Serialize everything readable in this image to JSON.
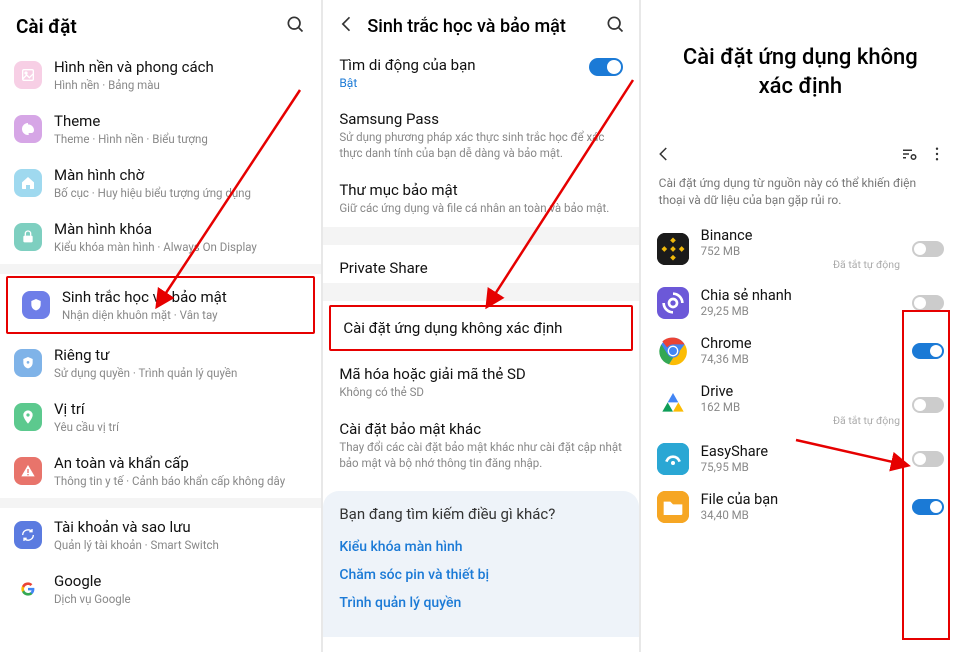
{
  "panel1": {
    "title": "Cài đặt",
    "items": [
      {
        "title": "Hình nền và phong cách",
        "sub": "Hình nền · Bảng màu",
        "bg": "#f7cfe5",
        "icon": "image"
      },
      {
        "title": "Theme",
        "sub": "Theme · Hình nền · Biểu tượng",
        "bg": "#d6a6e6",
        "icon": "palette"
      },
      {
        "title": "Màn hình chờ",
        "sub": "Bố cục · Huy hiệu biểu tượng ứng dụng",
        "bg": "#9fd9ef",
        "icon": "home"
      },
      {
        "title": "Màn hình khóa",
        "sub": "Kiểu khóa màn hình · Always On Display",
        "bg": "#7ecfc0",
        "icon": "lock"
      },
      {
        "title": "Sinh trắc học và bảo mật",
        "sub": "Nhận diện khuôn mặt · Vân tay",
        "bg": "#6e7ee8",
        "icon": "shield",
        "hl": true
      },
      {
        "title": "Riêng tư",
        "sub": "Sử dụng quyền · Trình quản lý quyền",
        "bg": "#7fb3e8",
        "icon": "privacy"
      },
      {
        "title": "Vị trí",
        "sub": "Yêu cầu vị trí",
        "bg": "#5cc98e",
        "icon": "pin"
      },
      {
        "title": "An toàn và khẩn cấp",
        "sub": "Thông tin y tế · Cảnh báo khẩn cấp không dây",
        "bg": "#e8746b",
        "icon": "alert"
      },
      {
        "title": "Tài khoản và sao lưu",
        "sub": "Quản lý tài khoản · Smart Switch",
        "bg": "#5b7be0",
        "icon": "sync"
      },
      {
        "title": "Google",
        "sub": "Dịch vụ Google",
        "bg": "#ffffff",
        "icon": "google"
      }
    ]
  },
  "panel2": {
    "title": "Sinh trắc học và bảo mật",
    "find": {
      "title": "Tìm di động của bạn",
      "state": "Bật"
    },
    "pass": {
      "title": "Samsung Pass",
      "sub": "Sử dụng phương pháp xác thực sinh trắc học để xác thực danh tính của bạn dễ dàng và bảo mật."
    },
    "secure": {
      "title": "Thư mục bảo mật",
      "sub": "Giữ các ứng dụng và file cá nhân an toàn và bảo mật."
    },
    "private_share": "Private Share",
    "unknown": {
      "title": "Cài đặt ứng dụng không xác định"
    },
    "sd": {
      "title": "Mã hóa hoặc giải mã thẻ SD",
      "sub": "Không có thẻ SD"
    },
    "other_sec": {
      "title": "Cài đặt bảo mật khác",
      "sub": "Thay đổi các cài đặt bảo mật khác như cài đặt cập nhật bảo mật và bộ nhớ thông tin đăng nhập."
    },
    "suggest": {
      "q": "Bạn đang tìm kiếm điều gì khác?",
      "links": [
        "Kiểu khóa màn hình",
        "Chăm sóc pin và thiết bị",
        "Trình quản lý quyền"
      ]
    }
  },
  "panel3": {
    "bigtitle": "Cài đặt ứng dụng không xác định",
    "warn": "Cài đặt ứng dụng từ nguồn này có thể khiến điện thoại và dữ liệu của bạn gặp rủi ro.",
    "auto_off": "Đã tắt tự động",
    "apps": [
      {
        "name": "Binance",
        "size": "752 MB",
        "on": false,
        "auto": true,
        "bg": "#2b2b2b"
      },
      {
        "name": "Chia sẻ nhanh",
        "size": "29,25 MB",
        "on": false,
        "bg": "#6c58d8"
      },
      {
        "name": "Chrome",
        "size": "74,36 MB",
        "on": true,
        "bg": "#ffffff"
      },
      {
        "name": "Drive",
        "size": "162 MB",
        "on": false,
        "auto": true,
        "bg": "#ffffff"
      },
      {
        "name": "EasyShare",
        "size": "75,95 MB",
        "on": false,
        "bg": "#2aa7d4"
      },
      {
        "name": "File của bạn",
        "size": "34,40 MB",
        "on": true,
        "bg": "#f6a623"
      }
    ]
  }
}
